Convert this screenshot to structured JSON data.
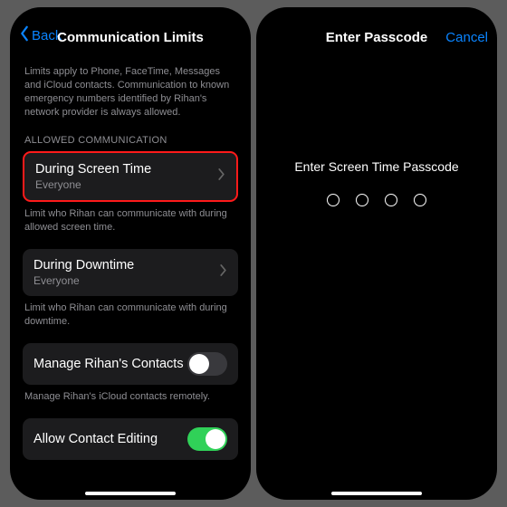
{
  "left": {
    "nav": {
      "back": "Back",
      "title": "Communication Limits"
    },
    "intro": "Limits apply to Phone, FaceTime, Messages and iCloud contacts. Communication to known emergency numbers identified by Rihan's network provider is always allowed.",
    "section_header": "ALLOWED COMMUNICATION",
    "during_screen_time": {
      "title": "During Screen Time",
      "subtitle": "Everyone"
    },
    "during_screen_time_footer": "Limit who Rihan can communicate with during allowed screen time.",
    "during_downtime": {
      "title": "During Downtime",
      "subtitle": "Everyone"
    },
    "during_downtime_footer": "Limit who Rihan can communicate with during downtime.",
    "manage_contacts": {
      "title": "Manage Rihan's Contacts"
    },
    "manage_contacts_footer": "Manage Rihan's iCloud contacts remotely.",
    "allow_editing": {
      "title": "Allow Contact Editing"
    }
  },
  "right": {
    "nav": {
      "title": "Enter Passcode",
      "cancel": "Cancel"
    },
    "prompt": "Enter Screen Time Passcode"
  }
}
